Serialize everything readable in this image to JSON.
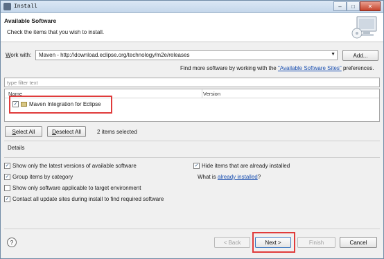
{
  "window": {
    "title": "Install",
    "minimize": "–",
    "maximize": "□",
    "close": "✕"
  },
  "header": {
    "title": "Available Software",
    "description": "Check the items that you wish to install."
  },
  "work_with": {
    "label_pre": "W",
    "label_rest": "ork with:",
    "value": "Maven - http://download.eclipse.org/technology/m2e/releases",
    "add_button": "Add...",
    "find_more_text": "Find more software by working with the ",
    "find_more_link": "\"Available Software Sites\"",
    "find_more_suffix": " preferences."
  },
  "filter": {
    "placeholder": "type filter text"
  },
  "table": {
    "columns": [
      "Name",
      "Version"
    ],
    "rows": [
      {
        "label": "Maven Integration for Eclipse",
        "checked": true,
        "version": ""
      }
    ]
  },
  "selection": {
    "select_all": "Select All",
    "deselect_all": "Deselect All",
    "count": "2 items selected"
  },
  "details": {
    "label": "Details"
  },
  "options": {
    "latest_versions": {
      "label": "Show only the latest versions of available software",
      "checked": true
    },
    "hide_installed": {
      "label": "Hide items that are already installed",
      "checked": true
    },
    "group_by_category": {
      "label": "Group items by category",
      "checked": true
    },
    "what_is_text": "What is ",
    "what_is_link": "already installed",
    "what_is_suffix": "?",
    "target_env": {
      "label": "Show only software applicable to target environment",
      "checked": false
    },
    "contact_sites": {
      "label": "Contact all update sites during install to find required software",
      "checked": true
    }
  },
  "footer": {
    "help": "?",
    "back": "< Back",
    "next": "Next >",
    "finish": "Finish",
    "cancel": "Cancel"
  },
  "colors": {
    "highlight": "#e03b3b",
    "link": "#1a4fb0"
  }
}
